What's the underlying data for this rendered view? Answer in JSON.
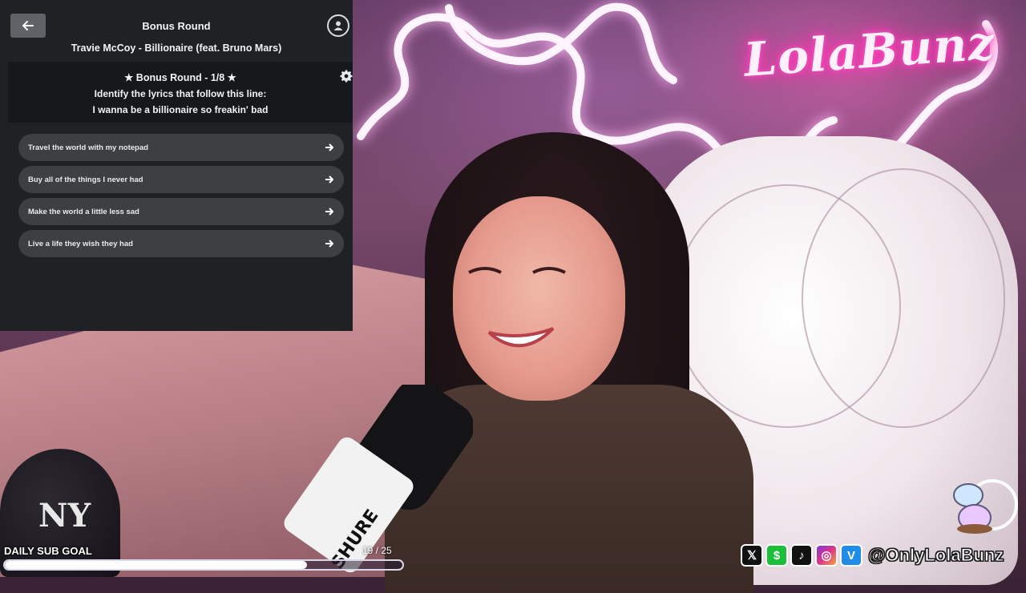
{
  "quiz": {
    "title": "Bonus Round",
    "song": "Travie McCoy - Billionaire (feat. Bruno Mars)",
    "round_label": "★ Bonus Round - 1/8 ★",
    "instruction": "Identify the lyrics that follow this line:",
    "lyric_line": "I wanna be a billionaire so freakin' bad",
    "answers": [
      {
        "label": "Travel the world with my notepad"
      },
      {
        "label": "Buy all of the things I never had"
      },
      {
        "label": "Make the world a little less sad"
      },
      {
        "label": "Live a life they wish they had"
      }
    ]
  },
  "overlay": {
    "neon_sign": "LolaBunz",
    "sub_goal_label": "DAILY SUB GOAL",
    "sub_goal_count": "19  / 25",
    "sub_goal_progress": 0.76,
    "social_handle": "@OnlyLolaBunz",
    "mic_brand": "SHURE",
    "cap_logo": "NY",
    "social_icons": [
      "x-icon",
      "cashapp-icon",
      "tiktok-icon",
      "instagram-icon",
      "venmo-icon"
    ]
  }
}
